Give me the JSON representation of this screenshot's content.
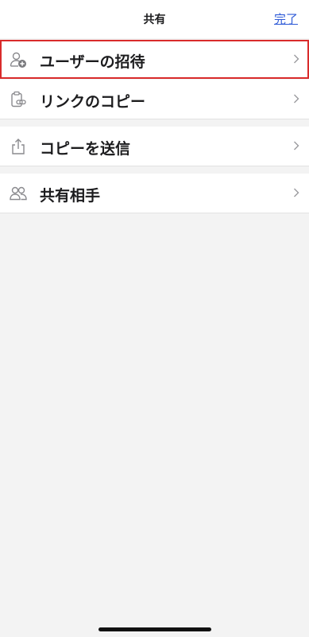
{
  "header": {
    "title": "共有",
    "done_label": "完了"
  },
  "menu": {
    "items": [
      {
        "label": "ユーザーの招待",
        "icon": "invite-user-icon",
        "selected": true
      },
      {
        "label": "リンクのコピー",
        "icon": "copy-link-icon"
      },
      {
        "label": "コピーを送信",
        "icon": "share-upload-icon"
      },
      {
        "label": "共有相手",
        "icon": "people-icon"
      }
    ]
  },
  "colors": {
    "accent": "#2f5bd7",
    "selection_border": "#d92b2b",
    "background": "#f3f3f3"
  }
}
